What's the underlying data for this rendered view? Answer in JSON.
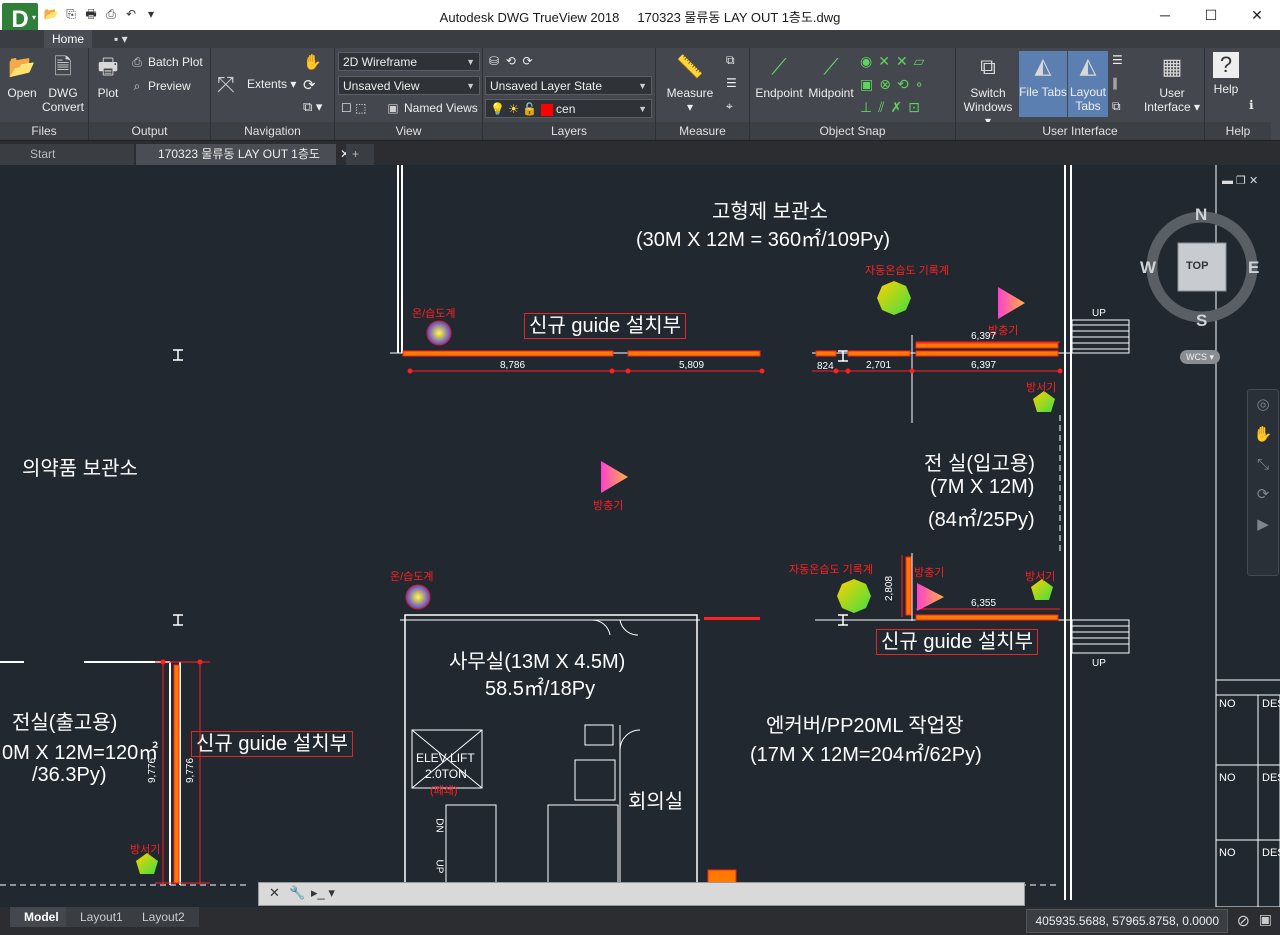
{
  "app": {
    "title": "Autodesk DWG TrueView 2018",
    "document": "170323 물류동 LAY OUT 1층도.dwg",
    "logo_letter": "D"
  },
  "window_controls": {
    "minimize": "─",
    "maximize": "☐",
    "close": "✕"
  },
  "ribbon_tabs": {
    "home": "Home",
    "extra": "▪ ▾"
  },
  "ribbon": {
    "files": {
      "title": "Files",
      "open": "Open",
      "dwg_convert_1": "DWG",
      "dwg_convert_2": "Convert"
    },
    "output": {
      "title": "Output",
      "plot": "Plot",
      "batch_plot": "Batch Plot",
      "preview": "Preview"
    },
    "navigation": {
      "title": "Navigation",
      "extents": "Extents"
    },
    "view": {
      "title": "View",
      "visual_style": "2D Wireframe",
      "saved_view": "Unsaved View",
      "named_views": "Named Views"
    },
    "layers": {
      "title": "Layers",
      "layer_state": "Unsaved Layer State",
      "current_layer": "cen"
    },
    "measure": {
      "title": "Measure",
      "measure": "Measure"
    },
    "object_snap": {
      "title": "Object Snap",
      "endpoint": "Endpoint",
      "midpoint": "Midpoint"
    },
    "user_interface": {
      "title": "User Interface",
      "switch_1": "Switch",
      "switch_2": "Windows",
      "file_tabs": "File Tabs",
      "layout_1": "Layout",
      "layout_2": "Tabs",
      "user_1": "User",
      "user_2": "Interface"
    },
    "help": {
      "title": "Help",
      "help": "Help"
    }
  },
  "doc_tabs": {
    "start": "Start",
    "active": "170323 물류동 LAY OUT 1층도",
    "add": "+"
  },
  "drawing": {
    "room_solid_storage": "고형제 보관소",
    "room_solid_storage_size": "(30M X 12M = 360㎡/109Py)",
    "room_pharma_storage": "의약품 보관소",
    "room_front_in": "전 실(입고용)",
    "room_front_in_size": "(7M X 12M)",
    "room_front_in_area": "(84㎡/25Py)",
    "room_office": "사무실(13M X 4.5M)",
    "room_office_area": "58.5㎡/18Py",
    "room_front_out": "전실(출고용)",
    "room_front_out_size": "0M X 12M=120㎡",
    "room_front_out_area": "/36.3Py)",
    "room_work": "엔커버/PP20ML 작업장",
    "room_work_size": "(17M X 12M=204㎡/62Py)",
    "room_meeting": "회의실",
    "elev_1": "ELEV LIFT",
    "elev_2": "2.0TON",
    "elev_3": "(폐쇄)",
    "guide_label": "신규 guide 설치부",
    "label_thermo": "온/습도계",
    "label_recorder": "자동온습도 기록계",
    "label_insect": "방충기",
    "label_rat": "방서기",
    "label_up": "UP",
    "label_dn": "DN",
    "dims": {
      "d1": "8,786",
      "d2": "5,809",
      "d3": "824",
      "d4": "2,701",
      "d5": "6,397",
      "d6": "6,397",
      "d7": "6,355",
      "d8": "2,808",
      "d9": "9,776",
      "d10": "9,776"
    },
    "title_block_no": "NO",
    "title_block_des": "DES"
  },
  "viewcube": {
    "n": "N",
    "s": "S",
    "e": "E",
    "w": "W",
    "face": "TOP",
    "wcs": "WCS"
  },
  "layout_tabs": {
    "model": "Model",
    "layout1": "Layout1",
    "layout2": "Layout2"
  },
  "status": {
    "coords": "405935.5688, 57965.8758, 0.0000"
  }
}
